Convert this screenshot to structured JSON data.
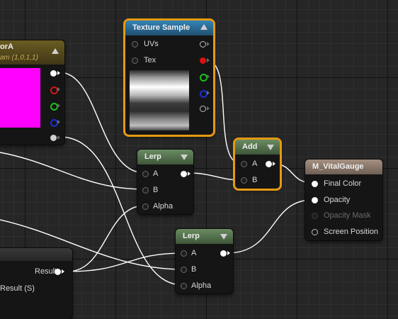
{
  "nodes": {
    "constant_vector": {
      "title": "orA",
      "subtitle": "am (1,0,1,1)",
      "preview_color": "#ff00ff"
    },
    "texture_sample": {
      "title": "Texture Sample",
      "header_color": "#2c6d97",
      "inputs": [
        "UVs",
        "Tex"
      ]
    },
    "lerp1": {
      "title": "Lerp",
      "header_color": "#55724f",
      "inputs": [
        "A",
        "B",
        "Alpha"
      ]
    },
    "lerp2": {
      "title": "Lerp",
      "header_color": "#55724f",
      "inputs": [
        "A",
        "B",
        "Alpha"
      ]
    },
    "add": {
      "title": "Add",
      "header_color": "#55724f",
      "inputs": [
        "A",
        "B"
      ]
    },
    "material": {
      "title": "M_VitalGauge",
      "header_color": "#8f7c6e",
      "inputs": [
        "Final Color",
        "Opacity",
        "Opacity Mask",
        "Screen Position"
      ]
    },
    "result_node": {
      "output": "Result",
      "output2": "Result (S)"
    }
  },
  "colors": {
    "selection": "#e59a12",
    "wire": "#ffffff",
    "canvas": "#262626"
  }
}
